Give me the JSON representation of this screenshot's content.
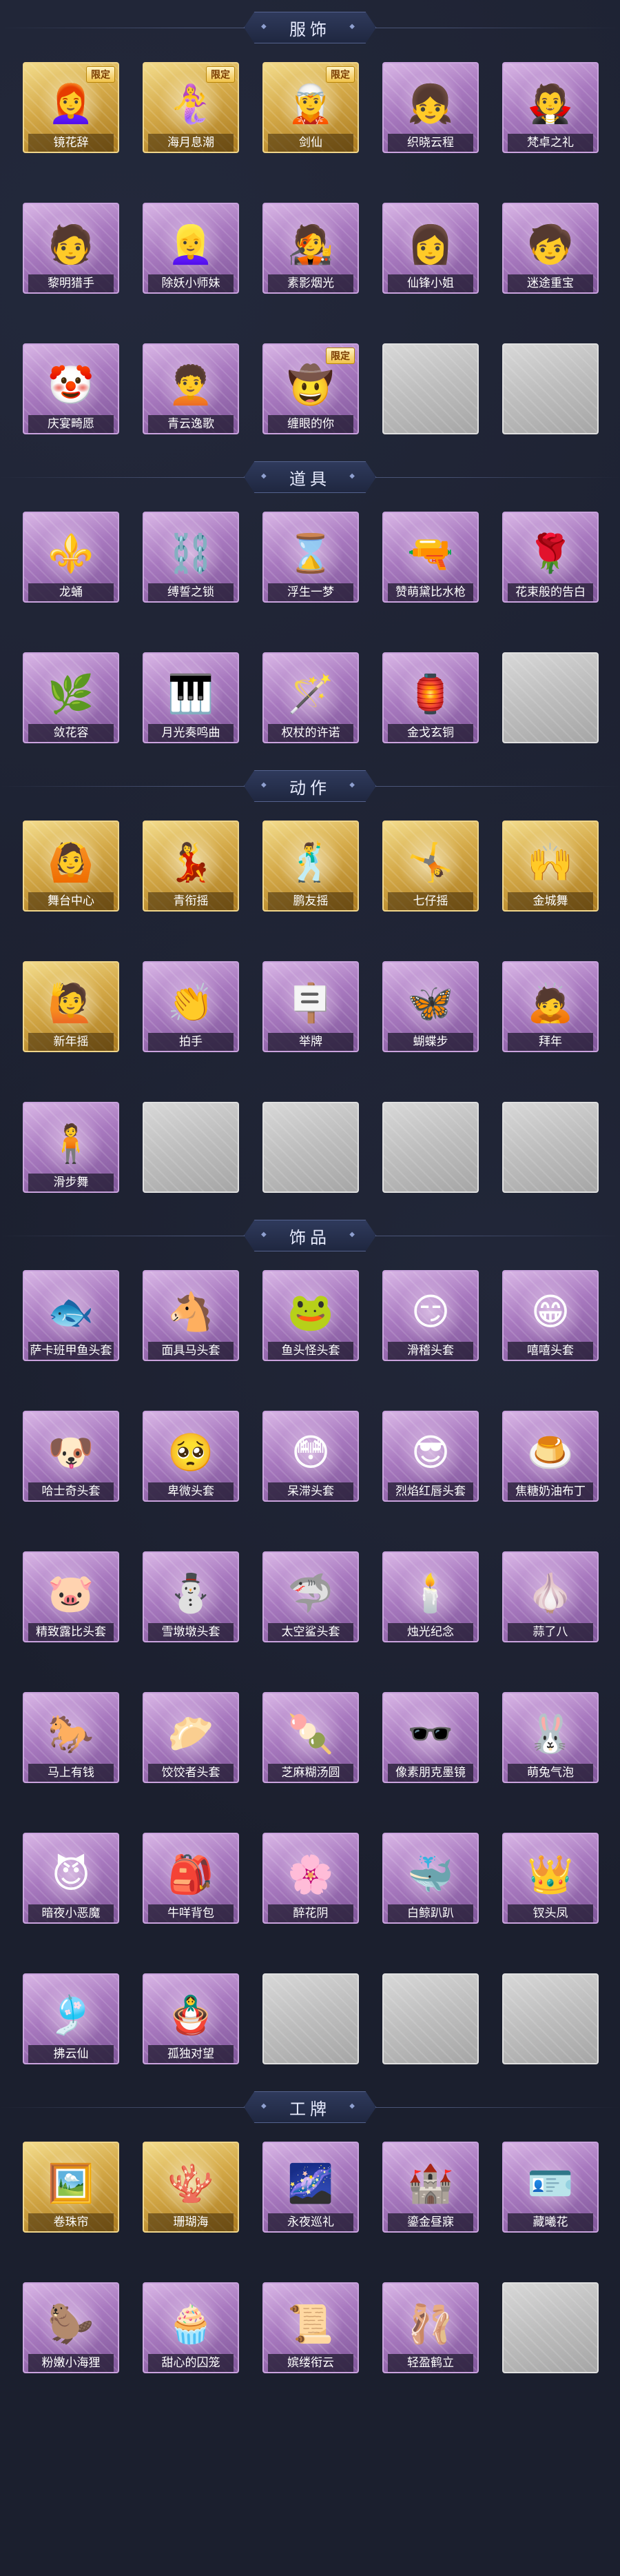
{
  "sections": [
    {
      "title": "服饰",
      "items": [
        {
          "label": "镜花辞",
          "rarity": "gold",
          "tag": "限定",
          "icon": "👩‍🦰",
          "icon_name": "red-hood-character-icon"
        },
        {
          "label": "海月息潮",
          "rarity": "gold",
          "tag": "限定",
          "icon": "🧜‍♀️",
          "icon_name": "mermaid-character-icon"
        },
        {
          "label": "剑仙",
          "rarity": "gold",
          "tag": "限定",
          "icon": "🧝",
          "icon_name": "sword-immortal-character-icon"
        },
        {
          "label": "织晓云程",
          "rarity": "purple",
          "tag": "",
          "icon": "👧",
          "icon_name": "white-hair-girl-character-icon"
        },
        {
          "label": "梵卓之礼",
          "rarity": "purple",
          "tag": "",
          "icon": "🧛",
          "icon_name": "vampire-character-icon"
        },
        {
          "label": "黎明猎手",
          "rarity": "purple",
          "tag": "",
          "icon": "🧑",
          "icon_name": "hunter-character-icon"
        },
        {
          "label": "除妖小师妹",
          "rarity": "purple",
          "tag": "",
          "icon": "👱‍♀️",
          "icon_name": "exorcist-girl-character-icon"
        },
        {
          "label": "素影烟光",
          "rarity": "purple",
          "tag": "",
          "icon": "🧑‍🎤",
          "icon_name": "silver-hair-character-icon"
        },
        {
          "label": "仙锋小姐",
          "rarity": "purple",
          "tag": "",
          "icon": "👩",
          "icon_name": "lady-character-icon"
        },
        {
          "label": "迷途重宝",
          "rarity": "purple",
          "tag": "",
          "icon": "🧒",
          "icon_name": "treasure-character-icon"
        },
        {
          "label": "庆宴畸愿",
          "rarity": "purple",
          "tag": "",
          "icon": "🤡",
          "icon_name": "clown-character-icon"
        },
        {
          "label": "青云逸歌",
          "rarity": "purple",
          "tag": "",
          "icon": "🧑‍🦱",
          "icon_name": "blue-hair-character-icon"
        },
        {
          "label": "缠眼的你",
          "rarity": "purple",
          "tag": "限定",
          "icon": "🤠",
          "icon_name": "cowboy-character-icon"
        },
        {
          "label": "",
          "rarity": "empty",
          "tag": "",
          "icon": "",
          "icon_name": "placeholder-logo-icon"
        },
        {
          "label": "",
          "rarity": "empty",
          "tag": "",
          "icon": "",
          "icon_name": "placeholder-logo-icon"
        }
      ]
    },
    {
      "title": "道具",
      "items": [
        {
          "label": "龙蛹",
          "rarity": "purple",
          "tag": "",
          "icon": "⚜️",
          "icon_name": "golden-staff-icon"
        },
        {
          "label": "缚誓之锁",
          "rarity": "purple",
          "tag": "",
          "icon": "⛓️",
          "icon_name": "chain-icon"
        },
        {
          "label": "浮生一梦",
          "rarity": "purple",
          "tag": "",
          "icon": "⌛",
          "icon_name": "hourglass-icon"
        },
        {
          "label": "赞萌黛比水枪",
          "rarity": "purple",
          "tag": "",
          "icon": "🔫",
          "icon_name": "water-gun-icon"
        },
        {
          "label": "花束般的告白",
          "rarity": "purple",
          "tag": "",
          "icon": "🌹",
          "icon_name": "rose-icon"
        },
        {
          "label": "敛花容",
          "rarity": "purple",
          "tag": "",
          "icon": "🌿",
          "icon_name": "flower-vine-icon"
        },
        {
          "label": "月光奏鸣曲",
          "rarity": "purple",
          "tag": "",
          "icon": "🎹",
          "icon_name": "piano-icon"
        },
        {
          "label": "权杖的许诺",
          "rarity": "purple",
          "tag": "",
          "icon": "🪄",
          "icon_name": "scepter-icon"
        },
        {
          "label": "金戈玄铜",
          "rarity": "purple",
          "tag": "",
          "icon": "🏮",
          "icon_name": "bronze-lantern-icon"
        },
        {
          "label": "",
          "rarity": "empty",
          "tag": "",
          "icon": "",
          "icon_name": "placeholder-logo-icon"
        }
      ]
    },
    {
      "title": "动作",
      "items": [
        {
          "label": "舞台中心",
          "rarity": "gold",
          "tag": "",
          "icon": "🙆",
          "icon_name": "stage-pose-icon"
        },
        {
          "label": "青衔摇",
          "rarity": "gold",
          "tag": "",
          "icon": "💃",
          "icon_name": "dance-pose-icon"
        },
        {
          "label": "鹏友摇",
          "rarity": "gold",
          "tag": "",
          "icon": "🕺",
          "icon_name": "friend-dance-icon"
        },
        {
          "label": "七仔摇",
          "rarity": "gold",
          "tag": "",
          "icon": "🤸",
          "icon_name": "spin-pose-icon"
        },
        {
          "label": "金城舞",
          "rarity": "gold",
          "tag": "",
          "icon": "🙌",
          "icon_name": "city-dance-icon"
        },
        {
          "label": "新年摇",
          "rarity": "gold",
          "tag": "",
          "icon": "🙋",
          "icon_name": "new-year-dance-icon"
        },
        {
          "label": "拍手",
          "rarity": "purple",
          "tag": "",
          "icon": "👏",
          "icon_name": "clap-icon"
        },
        {
          "label": "举牌",
          "rarity": "purple",
          "tag": "",
          "icon": "🪧",
          "icon_name": "sign-icon"
        },
        {
          "label": "蝴蝶步",
          "rarity": "purple",
          "tag": "",
          "icon": "🦋",
          "icon_name": "butterfly-step-icon"
        },
        {
          "label": "拜年",
          "rarity": "purple",
          "tag": "",
          "icon": "🙇",
          "icon_name": "bow-icon"
        },
        {
          "label": "滑步舞",
          "rarity": "purple",
          "tag": "",
          "icon": "🧍",
          "icon_name": "slide-dance-icon"
        },
        {
          "label": "",
          "rarity": "empty",
          "tag": "",
          "icon": "",
          "icon_name": "placeholder-logo-icon"
        },
        {
          "label": "",
          "rarity": "empty",
          "tag": "",
          "icon": "",
          "icon_name": "placeholder-logo-icon"
        },
        {
          "label": "",
          "rarity": "empty",
          "tag": "",
          "icon": "",
          "icon_name": "placeholder-logo-icon"
        },
        {
          "label": "",
          "rarity": "empty",
          "tag": "",
          "icon": "",
          "icon_name": "placeholder-logo-icon"
        }
      ]
    },
    {
      "title": "饰品",
      "items": [
        {
          "label": "萨卡班甲鱼头套",
          "rarity": "purple",
          "tag": "",
          "icon": "🐟",
          "icon_name": "fish-head-icon"
        },
        {
          "label": "面具马头套",
          "rarity": "purple",
          "tag": "",
          "icon": "🐴",
          "icon_name": "horse-head-icon"
        },
        {
          "label": "鱼头怪头套",
          "rarity": "purple",
          "tag": "",
          "icon": "🐸",
          "icon_name": "fish-monster-head-icon"
        },
        {
          "label": "滑稽头套",
          "rarity": "purple",
          "tag": "",
          "icon": "😏",
          "icon_name": "funny-face-icon"
        },
        {
          "label": "嘻嘻头套",
          "rarity": "purple",
          "tag": "",
          "icon": "😁",
          "icon_name": "grin-face-icon"
        },
        {
          "label": "哈士奇头套",
          "rarity": "purple",
          "tag": "",
          "icon": "🐶",
          "icon_name": "husky-head-icon"
        },
        {
          "label": "卑微头套",
          "rarity": "purple",
          "tag": "",
          "icon": "🥺",
          "icon_name": "humble-face-icon"
        },
        {
          "label": "呆滞头套",
          "rarity": "purple",
          "tag": "",
          "icon": "😳",
          "icon_name": "dazed-face-icon"
        },
        {
          "label": "烈焰红唇头套",
          "rarity": "purple",
          "tag": "",
          "icon": "😎",
          "icon_name": "red-lips-head-icon"
        },
        {
          "label": "焦糖奶油布丁",
          "rarity": "purple",
          "tag": "",
          "icon": "🍮",
          "icon_name": "pudding-icon"
        },
        {
          "label": "精致露比头套",
          "rarity": "purple",
          "tag": "",
          "icon": "🐷",
          "icon_name": "pink-head-icon"
        },
        {
          "label": "雪墩墩头套",
          "rarity": "purple",
          "tag": "",
          "icon": "⛄",
          "icon_name": "snowman-head-icon"
        },
        {
          "label": "太空鲨头套",
          "rarity": "purple",
          "tag": "",
          "icon": "🦈",
          "icon_name": "shark-head-icon"
        },
        {
          "label": "烛光纪念",
          "rarity": "purple",
          "tag": "",
          "icon": "🕯️",
          "icon_name": "candle-icon"
        },
        {
          "label": "蒜了八",
          "rarity": "purple",
          "tag": "",
          "icon": "🧄",
          "icon_name": "garlic-icon"
        },
        {
          "label": "马上有钱",
          "rarity": "purple",
          "tag": "",
          "icon": "🐎",
          "icon_name": "money-horse-icon"
        },
        {
          "label": "饺饺者头套",
          "rarity": "purple",
          "tag": "",
          "icon": "🥟",
          "icon_name": "dumpling-head-icon"
        },
        {
          "label": "芝麻糊汤圆",
          "rarity": "purple",
          "tag": "",
          "icon": "🍡",
          "icon_name": "rice-ball-icon"
        },
        {
          "label": "像素朋克墨镜",
          "rarity": "purple",
          "tag": "",
          "icon": "🕶️",
          "icon_name": "pixel-sunglasses-icon"
        },
        {
          "label": "萌兔气泡",
          "rarity": "purple",
          "tag": "",
          "icon": "🐰",
          "icon_name": "bunny-bubble-icon"
        },
        {
          "label": "暗夜小恶魔",
          "rarity": "purple",
          "tag": "",
          "icon": "😈",
          "icon_name": "little-devil-icon"
        },
        {
          "label": "牛咩背包",
          "rarity": "purple",
          "tag": "",
          "icon": "🎒",
          "icon_name": "backpack-icon"
        },
        {
          "label": "醉花阴",
          "rarity": "purple",
          "tag": "",
          "icon": "🌸",
          "icon_name": "flower-ornament-icon"
        },
        {
          "label": "白鲸趴趴",
          "rarity": "purple",
          "tag": "",
          "icon": "🐳",
          "icon_name": "beluga-icon"
        },
        {
          "label": "钗头凤",
          "rarity": "purple",
          "tag": "",
          "icon": "👑",
          "icon_name": "phoenix-hairpin-icon"
        },
        {
          "label": "拂云仙",
          "rarity": "purple",
          "tag": "",
          "icon": "🎐",
          "icon_name": "cloud-charm-icon"
        },
        {
          "label": "孤独对望",
          "rarity": "purple",
          "tag": "",
          "icon": "🪆",
          "icon_name": "doll-pendant-icon"
        },
        {
          "label": "",
          "rarity": "empty",
          "tag": "",
          "icon": "",
          "icon_name": "placeholder-logo-icon"
        },
        {
          "label": "",
          "rarity": "empty",
          "tag": "",
          "icon": "",
          "icon_name": "placeholder-logo-icon"
        },
        {
          "label": "",
          "rarity": "empty",
          "tag": "",
          "icon": "",
          "icon_name": "placeholder-logo-icon"
        }
      ]
    },
    {
      "title": "工牌",
      "items": [
        {
          "label": "卷珠帘",
          "rarity": "gold",
          "tag": "",
          "icon": "🖼️",
          "icon_name": "badge-frame-icon"
        },
        {
          "label": "珊瑚海",
          "rarity": "gold",
          "tag": "",
          "icon": "🪸",
          "icon_name": "coral-badge-icon"
        },
        {
          "label": "永夜巡礼",
          "rarity": "purple",
          "tag": "",
          "icon": "🌌",
          "icon_name": "night-badge-icon"
        },
        {
          "label": "鎏金昼寐",
          "rarity": "purple",
          "tag": "",
          "icon": "🏰",
          "icon_name": "gold-badge-icon"
        },
        {
          "label": "藏曦花",
          "rarity": "purple",
          "tag": "",
          "icon": "🪪",
          "icon_name": "lilac-badge-icon"
        },
        {
          "label": "粉嫩小海狸",
          "rarity": "purple",
          "tag": "",
          "icon": "🦫",
          "icon_name": "beaver-badge-icon"
        },
        {
          "label": "甜心的囚笼",
          "rarity": "purple",
          "tag": "",
          "icon": "🧁",
          "icon_name": "sweet-cage-badge-icon"
        },
        {
          "label": "嫔缕衔云",
          "rarity": "purple",
          "tag": "",
          "icon": "📜",
          "icon_name": "scroll-badge-icon"
        },
        {
          "label": "轻盈鹤立",
          "rarity": "purple",
          "tag": "",
          "icon": "🩰",
          "icon_name": "dancer-badge-icon"
        },
        {
          "label": "",
          "rarity": "empty",
          "tag": "",
          "icon": "",
          "icon_name": "placeholder-logo-icon"
        }
      ]
    }
  ]
}
